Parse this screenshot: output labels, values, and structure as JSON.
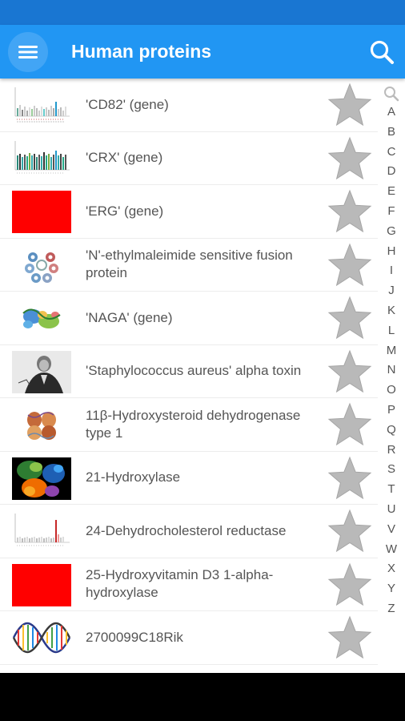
{
  "app_bar": {
    "title": "Human proteins",
    "menu_icon": "hamburger-menu-icon",
    "search_icon": "search-icon"
  },
  "colors": {
    "status_bar": "#1976d2",
    "app_bar": "#2196f3",
    "menu_circle": "#42a5f5",
    "star": "#b9b9b9"
  },
  "items": [
    {
      "label": "'CD82' (gene)",
      "thumb": "chart-thumbnail",
      "favorite_icon": "star-icon"
    },
    {
      "label": "'CRX' (gene)",
      "thumb": "chart-thumbnail",
      "favorite_icon": "star-icon"
    },
    {
      "label": "'ERG' (gene)",
      "thumb": "red-placeholder",
      "favorite_icon": "star-icon"
    },
    {
      "label": "'N'-ethylmaleimide sensitive fusion protein",
      "thumb": "protein-structure-image",
      "favorite_icon": "star-icon"
    },
    {
      "label": "'NAGA' (gene)",
      "thumb": "protein-structure-image",
      "favorite_icon": "star-icon"
    },
    {
      "label": "'Staphylococcus aureus' alpha toxin",
      "thumb": "portrait-engraving",
      "favorite_icon": "star-icon"
    },
    {
      "label": "11β-Hydroxysteroid dehydrogenase type 1",
      "thumb": "protein-structure-image",
      "favorite_icon": "star-icon"
    },
    {
      "label": "21-Hydroxylase",
      "thumb": "protein-structure-image",
      "favorite_icon": "star-icon"
    },
    {
      "label": "24-Dehydrocholesterol reductase",
      "thumb": "chart-thumbnail",
      "favorite_icon": "star-icon"
    },
    {
      "label": "25-Hydroxyvitamin D3 1-alpha-hydroxylase",
      "thumb": "red-placeholder",
      "favorite_icon": "star-icon"
    },
    {
      "label": "2700099C18Rik",
      "thumb": "dna-helix-image",
      "favorite_icon": "star-icon"
    }
  ],
  "index": {
    "search_icon": "search-icon",
    "letters": [
      "A",
      "B",
      "C",
      "D",
      "E",
      "F",
      "G",
      "H",
      "I",
      "J",
      "K",
      "L",
      "M",
      "N",
      "O",
      "P",
      "Q",
      "R",
      "S",
      "T",
      "U",
      "V",
      "W",
      "X",
      "Y",
      "Z"
    ]
  }
}
